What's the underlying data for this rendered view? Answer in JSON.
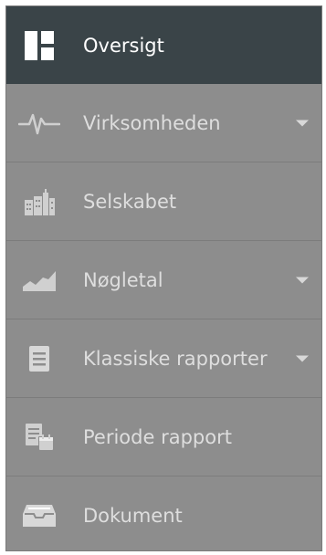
{
  "sidebar": {
    "items": [
      {
        "label": "Oversigt",
        "icon": "dashboard-icon",
        "active": true,
        "has_submenu": false
      },
      {
        "label": "Virksomheden",
        "icon": "pulse-icon",
        "active": false,
        "has_submenu": true
      },
      {
        "label": "Selskabet",
        "icon": "buildings-icon",
        "active": false,
        "has_submenu": false
      },
      {
        "label": "Nøgletal",
        "icon": "area-chart-icon",
        "active": false,
        "has_submenu": true
      },
      {
        "label": "Klassiske rapporter",
        "icon": "document-icon",
        "active": false,
        "has_submenu": true
      },
      {
        "label": "Periode rapport",
        "icon": "period-report-icon",
        "active": false,
        "has_submenu": false
      },
      {
        "label": "Dokument",
        "icon": "inbox-icon",
        "active": false,
        "has_submenu": false
      }
    ]
  },
  "colors": {
    "sidebar_bg": "#8d8d8d",
    "active_bg": "#3a4448",
    "text": "#dedede",
    "active_text": "#ffffff"
  }
}
